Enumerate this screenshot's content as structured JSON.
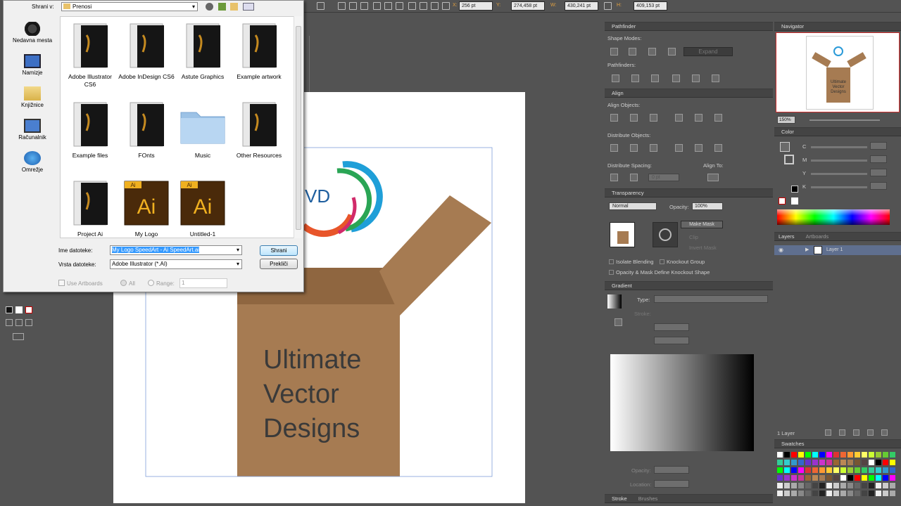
{
  "dialog": {
    "save_in_label": "Shrani v:",
    "location": "Prenosi",
    "places": [
      "Nedavna mesta",
      "Namizje",
      "Knjižnice",
      "Računalnik",
      "Omrežje"
    ],
    "files": [
      {
        "name": "Adobe Illustrator CS6",
        "kind": "folder-dark"
      },
      {
        "name": "Adobe InDesign CS6",
        "kind": "folder-dark"
      },
      {
        "name": "Astute Graphics",
        "kind": "folder-dark"
      },
      {
        "name": "Example artwork",
        "kind": "folder-dark"
      },
      {
        "name": "Example files",
        "kind": "folder-dark"
      },
      {
        "name": "FOnts",
        "kind": "folder-dark"
      },
      {
        "name": "Music",
        "kind": "folder-blue"
      },
      {
        "name": "Other Resources",
        "kind": "folder-dark"
      },
      {
        "name": "Project Ai",
        "kind": "folder-dark"
      },
      {
        "name": "My Logo",
        "kind": "ai-file"
      },
      {
        "name": "Untitled-1",
        "kind": "ai-file"
      }
    ],
    "filename_label": "Ime datoteke:",
    "filename_value": "My Logo SpeedArt - Ai SpeedArt.ai",
    "filetype_label": "Vrsta datoteke:",
    "filetype_value": "Adobe Illustrator (*.AI)",
    "save_button": "Shrani",
    "cancel_button": "Prekliči",
    "use_artboards": "Use Artboards",
    "all_label": "All",
    "range_label": "Range:",
    "range_value": "1"
  },
  "topbar": {
    "x_value": "256 pt",
    "y_value": "274,458 pt",
    "w_value": "430,241 pt",
    "h_value": "409,153 pt",
    "x_label": "X:",
    "y_label": "Y:",
    "w_label": "W:",
    "h_label": "H:"
  },
  "artwork": {
    "logo_text": "VD",
    "text_line1": "Ultimate",
    "text_line2": "Vector",
    "text_line3": "Designs",
    "box_color": "#a67b52"
  },
  "panels": {
    "pathfinder": {
      "title": "Pathfinder",
      "shape_modes": "Shape Modes:",
      "expand": "Expand",
      "pathfinders": "Pathfinders:"
    },
    "align": {
      "title": "Align",
      "align_objects": "Align Objects:",
      "distribute_objects": "Distribute Objects:",
      "distribute_spacing": "Distribute Spacing:",
      "align_to": "Align To:",
      "spacing_value": "0 pt"
    },
    "transparency": {
      "title": "Transparency",
      "blend_mode": "Normal",
      "opacity_label": "Opacity:",
      "opacity_value": "100%",
      "make_mask": "Make Mask",
      "clip": "Clip",
      "invert_mask": "Invert Mask",
      "isolate_blending": "Isolate Blending",
      "knockout_group": "Knockout Group",
      "opacity_mask": "Opacity & Mask Define Knockout Shape"
    },
    "gradient": {
      "title": "Gradient",
      "type_label": "Type:",
      "stroke_label": "Stroke:",
      "opacity_label": "Opacity:",
      "location_label": "Location:"
    },
    "stroke_tab": "Stroke",
    "brushes_tab": "Brushes",
    "navigator": {
      "title": "Navigator",
      "zoom": "150%",
      "thumb_l1": "Ultimate",
      "thumb_l2": "Vector",
      "thumb_l3": "Designs"
    },
    "color": {
      "title": "Color",
      "channels": [
        "C",
        "M",
        "Y",
        "K"
      ]
    },
    "layers": {
      "tab1": "Layers",
      "tab2": "Artboards",
      "layer_name": "Layer 1",
      "count": "1 Layer"
    },
    "swatches": {
      "title": "Swatches"
    }
  }
}
